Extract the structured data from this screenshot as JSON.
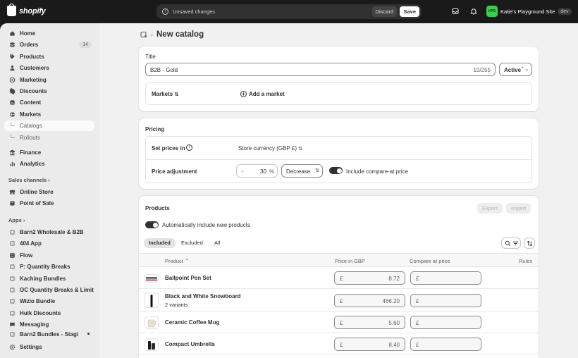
{
  "topbar": {
    "brand": "shopify",
    "unsaved_text": "Unsaved changes",
    "discard": "Discard",
    "save": "Save",
    "store_initials": "KPS",
    "store_name": "Katie's Playground Site",
    "store_env": "dev"
  },
  "sidebar": {
    "items": [
      {
        "label": "Home",
        "icon": "home-icon"
      },
      {
        "label": "Orders",
        "icon": "orders-icon",
        "badge": "14"
      },
      {
        "label": "Products",
        "icon": "tag-icon"
      },
      {
        "label": "Customers",
        "icon": "person-icon"
      },
      {
        "label": "Marketing",
        "icon": "target-icon"
      },
      {
        "label": "Discounts",
        "icon": "discount-icon"
      },
      {
        "label": "Content",
        "icon": "content-icon"
      },
      {
        "label": "Markets",
        "icon": "globe-icon"
      },
      {
        "label": "Catalogs",
        "icon": "",
        "sub": true,
        "active": true
      },
      {
        "label": "Rollouts",
        "icon": "",
        "sub": true
      },
      {
        "label": "Finance",
        "icon": "bank-icon"
      },
      {
        "label": "Analytics",
        "icon": "chart-icon"
      }
    ],
    "sales_channels_label": "Sales channels",
    "channels": [
      {
        "label": "Online Store",
        "icon": "store-icon"
      },
      {
        "label": "Point of Sale",
        "icon": "pos-icon"
      }
    ],
    "apps_label": "Apps",
    "apps": [
      {
        "label": "Barn2 Wholesale & B2B",
        "icon": "app-icon"
      },
      {
        "label": "404 App",
        "icon": "app-icon"
      },
      {
        "label": "Flow",
        "icon": "flow-icon"
      },
      {
        "label": "P: Quantity Breaks",
        "icon": "app-icon"
      },
      {
        "label": "Kaching Bundles",
        "icon": "app-icon"
      },
      {
        "label": "OC Quantity Breaks & Limit",
        "icon": "app-icon"
      },
      {
        "label": "Wizio Bundle",
        "icon": "app-icon"
      },
      {
        "label": "Hulk Discounts",
        "icon": "app-icon"
      },
      {
        "label": "Messaging",
        "icon": "message-icon"
      },
      {
        "label": "Barn2 Bundles - Stagi",
        "icon": "app-icon"
      }
    ],
    "settings": "Settings"
  },
  "page": {
    "title": "New catalog"
  },
  "title_card": {
    "label": "Title",
    "value": "B2B - Gold",
    "counter": "10/255",
    "status": "Active",
    "markets_label": "Markets",
    "add_market": "Add a market"
  },
  "pricing": {
    "heading": "Pricing",
    "set_prices_label": "Set prices in",
    "currency": "Store currency (GBP £)",
    "adjust_label": "Price adjustment",
    "adjust_sign": "-",
    "adjust_value": "30",
    "adjust_unit": "%",
    "adjust_mode": "Decrease",
    "compare_label": "Include compare-at price"
  },
  "products": {
    "heading": "Products",
    "export": "Export",
    "import": "Import",
    "auto_include": "Automatically include new products",
    "tabs": [
      "Included",
      "Excluded",
      "All"
    ],
    "columns": {
      "product": "Product",
      "price": "Price in GBP",
      "compare": "Compare at price",
      "rules": "Rules"
    },
    "currency_symbol": "£",
    "rows": [
      {
        "name": "Ballpoint Pen Set",
        "variants": "",
        "price": "8.72",
        "compare": ""
      },
      {
        "name": "Black and White Snowboard",
        "variants": "2 variants",
        "price": "466.20",
        "compare": ""
      },
      {
        "name": "Ceramic Coffee Mug",
        "variants": "",
        "price": "5.60",
        "compare": ""
      },
      {
        "name": "Compact Umbrella",
        "variants": "",
        "price": "8.40",
        "compare": ""
      }
    ]
  }
}
